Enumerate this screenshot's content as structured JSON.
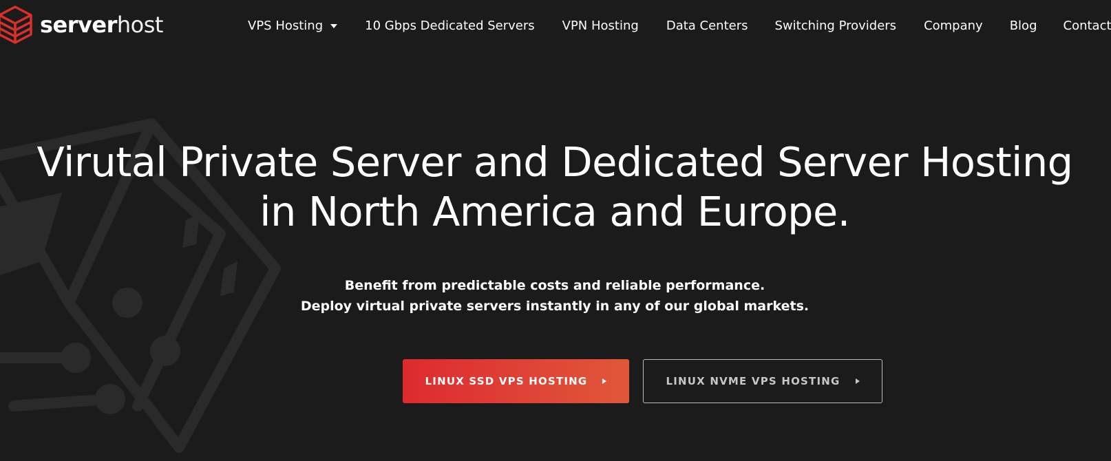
{
  "brand": {
    "name_bold": "server",
    "name_light": "host",
    "colors": {
      "accent": "#dd2a2f",
      "background": "#1c1b1b"
    }
  },
  "nav": {
    "items": [
      {
        "label": "VPS Hosting",
        "has_dropdown": true
      },
      {
        "label": "10 Gbps Dedicated Servers"
      },
      {
        "label": "VPN Hosting"
      },
      {
        "label": "Data Centers"
      },
      {
        "label": "Switching Providers"
      },
      {
        "label": "Company"
      },
      {
        "label": "Blog"
      },
      {
        "label": "Contact"
      }
    ],
    "dropdown_icon": "caret-down-icon"
  },
  "hero": {
    "title_line1": "Virutal Private Server and Dedicated Server Hosting",
    "title_line2": "in North America and Europe.",
    "subtitle_line1": "Benefit from predictable costs and reliable performance.",
    "subtitle_line2": "Deploy virtual private servers instantly in any of our global markets.",
    "buttons": {
      "primary_label": "LINUX SSD VPS HOSTING",
      "secondary_label": "LINUX NVME VPS HOSTING",
      "arrow_icon": "play-arrow-icon"
    }
  }
}
